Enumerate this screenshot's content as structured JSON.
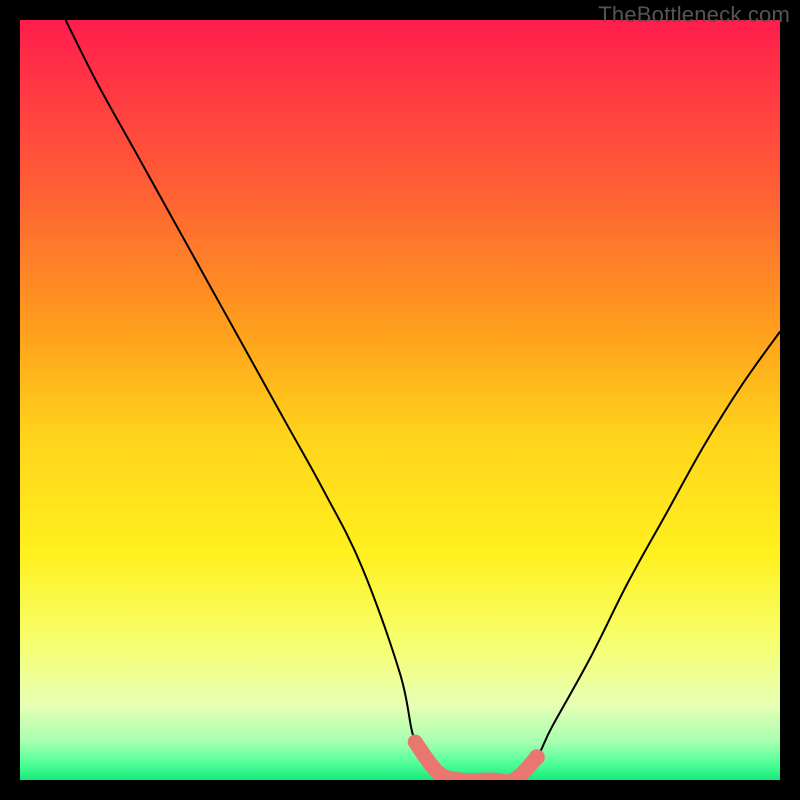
{
  "watermark": "TheBottleneck.com",
  "chart_data": {
    "type": "line",
    "title": "",
    "xlabel": "",
    "ylabel": "",
    "xlim": [
      0,
      100
    ],
    "ylim": [
      0,
      100
    ],
    "background_gradient": {
      "description": "Vertical gradient representing bottleneck severity: red (high) at top through orange/yellow to green (optimal) at bottom",
      "stops": [
        {
          "pos": 0.0,
          "color": "#ff1d4d"
        },
        {
          "pos": 0.2,
          "color": "#ff5837"
        },
        {
          "pos": 0.4,
          "color": "#ff9c1d"
        },
        {
          "pos": 0.55,
          "color": "#ffd41b"
        },
        {
          "pos": 0.7,
          "color": "#fff01e"
        },
        {
          "pos": 0.82,
          "color": "#f6ff6e"
        },
        {
          "pos": 0.9,
          "color": "#e8ffb4"
        },
        {
          "pos": 0.95,
          "color": "#a6ffb1"
        },
        {
          "pos": 0.98,
          "color": "#4bff98"
        },
        {
          "pos": 1.0,
          "color": "#17e87a"
        }
      ]
    },
    "series": [
      {
        "name": "bottleneck-curve",
        "description": "V-shaped bottleneck curve; x = relative component performance, y = bottleneck percentage. Left branch descends from top-left, flat minimum between x≈52–68, right branch rises toward upper right.",
        "x": [
          6,
          10,
          15,
          20,
          25,
          30,
          35,
          40,
          45,
          50,
          52,
          55,
          58,
          62,
          65,
          68,
          70,
          75,
          80,
          85,
          90,
          95,
          100
        ],
        "y": [
          100,
          92,
          83,
          74,
          65,
          56,
          47,
          38,
          28,
          14,
          5,
          1,
          0,
          0,
          0,
          3,
          7,
          16,
          26,
          35,
          44,
          52,
          59
        ]
      }
    ],
    "highlight": {
      "description": "Flat optimal (near-zero bottleneck) region along the valley bottom",
      "x": [
        52,
        55,
        58,
        62,
        65,
        68
      ],
      "y": [
        5,
        1,
        0,
        0,
        0,
        3
      ]
    },
    "marker_point": {
      "x": 68,
      "y": 3
    }
  }
}
